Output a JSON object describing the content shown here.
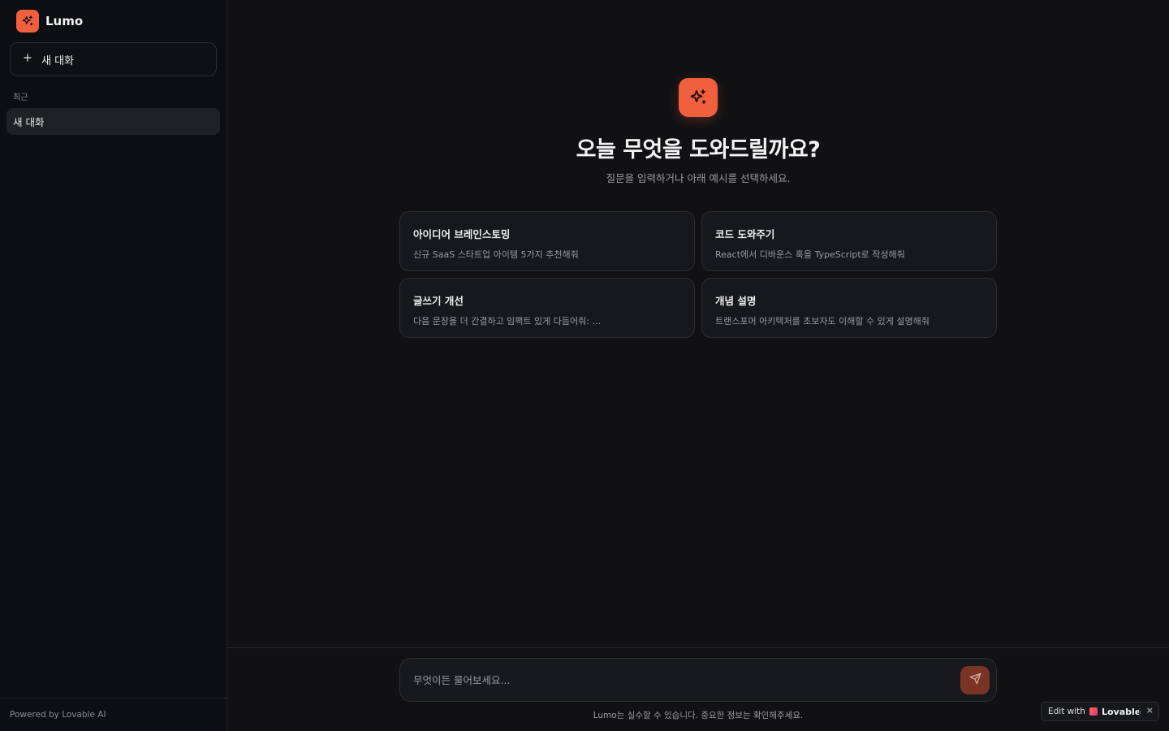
{
  "sidebar": {
    "brand_name": "Lumo",
    "new_chat_label": "새 대화",
    "recent_heading": "최근",
    "conversations": [
      {
        "title": "새 대화"
      }
    ],
    "footer": "Powered by Lovable AI"
  },
  "main": {
    "title": "오늘 무엇을 도와드릴까요?",
    "subtitle": "질문을 입력하거나 아래 예시를 선택하세요.",
    "suggestions": [
      {
        "title": "아이디어 브레인스토밍",
        "description": "신규 SaaS 스타트업 아이템 5가지 추천해줘"
      },
      {
        "title": "코드 도와주기",
        "description": "React에서 디바운스 훅을 TypeScript로 작성해줘"
      },
      {
        "title": "글쓰기 개선",
        "description": "다음 문장을 더 간결하고 임팩트 있게 다듬어줘: ..."
      },
      {
        "title": "개념 설명",
        "description": "트랜스포머 아키텍처를 초보자도 이해할 수 있게 설명해줘"
      }
    ],
    "composer": {
      "placeholder": "무엇이든 물어보세요...",
      "value": ""
    },
    "disclaimer": "Lumo는 실수할 수 있습니다. 중요한 정보는 확인해주세요."
  },
  "badge": {
    "edit_label": "Edit with",
    "brand": "Lovable",
    "close": "×"
  },
  "colors": {
    "accent": "#f0603f",
    "background": "#111113",
    "sidebar": "#0d0e11",
    "card": "#17181b",
    "send_button": "#7a3426"
  },
  "icons": {
    "brand": "sparkles-icon",
    "hero": "sparkles-icon",
    "new_chat": "plus-icon",
    "send": "send-icon"
  }
}
